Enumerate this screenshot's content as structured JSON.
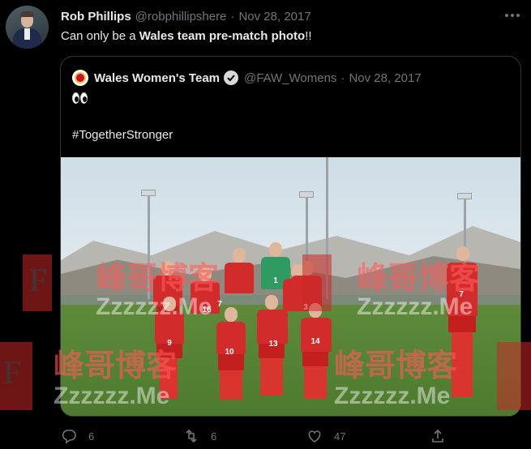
{
  "tweet": {
    "author_name": "Rob Phillips",
    "author_handle": "@robphillipshere",
    "separator": "·",
    "date": "Nov 28, 2017",
    "text_pre": "Can only be a ",
    "text_bold": "Wales team pre-match photo",
    "text_post": "!!"
  },
  "quoted": {
    "author_name": "Wales Women's Team",
    "author_handle": "@FAW_Womens",
    "separator": "·",
    "date": "Nov 28, 2017",
    "emoji_name": "eyes",
    "hashtag": "#TogetherStronger",
    "player_numbers": [
      "1",
      "16",
      "7",
      "3",
      "9",
      "10",
      "13",
      "14",
      "7"
    ]
  },
  "watermark": {
    "text_cn": "峰哥博客",
    "text_en": "Zzzzzz.Me",
    "letter": "F"
  },
  "actions": {
    "reply_count": "6",
    "retweet_count": "6",
    "like_count": "47"
  },
  "icons": [
    "more-icon",
    "verified-icon",
    "reply-icon",
    "retweet-icon",
    "like-icon",
    "share-icon"
  ],
  "colors": {
    "background": "#000000",
    "text": "#e7e9ea",
    "muted": "#71767b",
    "border": "#333639",
    "kit_red": "#d12b2b"
  }
}
